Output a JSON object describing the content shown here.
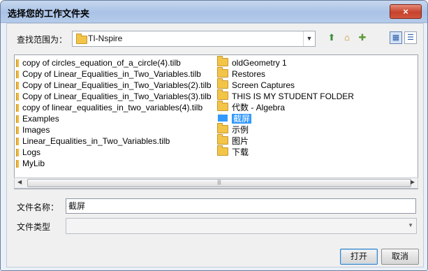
{
  "dialog": {
    "title": "选择您的工作文件夹",
    "close_label": "×"
  },
  "lookin": {
    "label": "查找范围为：",
    "value": "TI-Nspire"
  },
  "toolbar": {
    "up_icon": "folder-up-icon",
    "home_icon": "home-icon",
    "new_folder_icon": "new-folder-icon",
    "list_view_icon": "list-view-icon",
    "details_view_icon": "details-view-icon"
  },
  "files": {
    "col1": [
      {
        "name": "copy of circles_equation_of_a_circle(4).tilb",
        "kind": "file"
      },
      {
        "name": "Copy of Linear_Equalities_in_Two_Variables.tilb",
        "kind": "file"
      },
      {
        "name": "Copy of Linear_Equalities_in_Two_Variables(2).tilb",
        "kind": "file"
      },
      {
        "name": "Copy of Linear_Equalities_in_Two_Variables(3).tilb",
        "kind": "file"
      },
      {
        "name": "copy of linear_equalities_in_two_variables(4).tilb",
        "kind": "file"
      },
      {
        "name": "Examples",
        "kind": "file"
      },
      {
        "name": "Images",
        "kind": "file"
      },
      {
        "name": "Linear_Equalities_in_Two_Variables.tilb",
        "kind": "file"
      },
      {
        "name": "Logs",
        "kind": "file"
      },
      {
        "name": "MyLib",
        "kind": "file"
      }
    ],
    "col2": [
      {
        "name": "oldGeometry 1",
        "kind": "folder"
      },
      {
        "name": "Restores",
        "kind": "folder"
      },
      {
        "name": "Screen Captures",
        "kind": "folder"
      },
      {
        "name": "THIS IS MY STUDENT FOLDER",
        "kind": "folder"
      },
      {
        "name": "代数 - Algebra",
        "kind": "folder"
      },
      {
        "name": "截屏",
        "kind": "folder",
        "selected": true
      },
      {
        "name": "示例",
        "kind": "folder"
      },
      {
        "name": "图片",
        "kind": "folder"
      },
      {
        "name": "下载",
        "kind": "folder"
      }
    ]
  },
  "filename": {
    "label": "文件名称：",
    "value": "截屏"
  },
  "filetype": {
    "label": "文件类型",
    "value": ""
  },
  "buttons": {
    "open": "打开",
    "cancel": "取消"
  },
  "colors": {
    "selection": "#3399ff",
    "titlebar": "#b5cbea",
    "close": "#c6422b"
  }
}
